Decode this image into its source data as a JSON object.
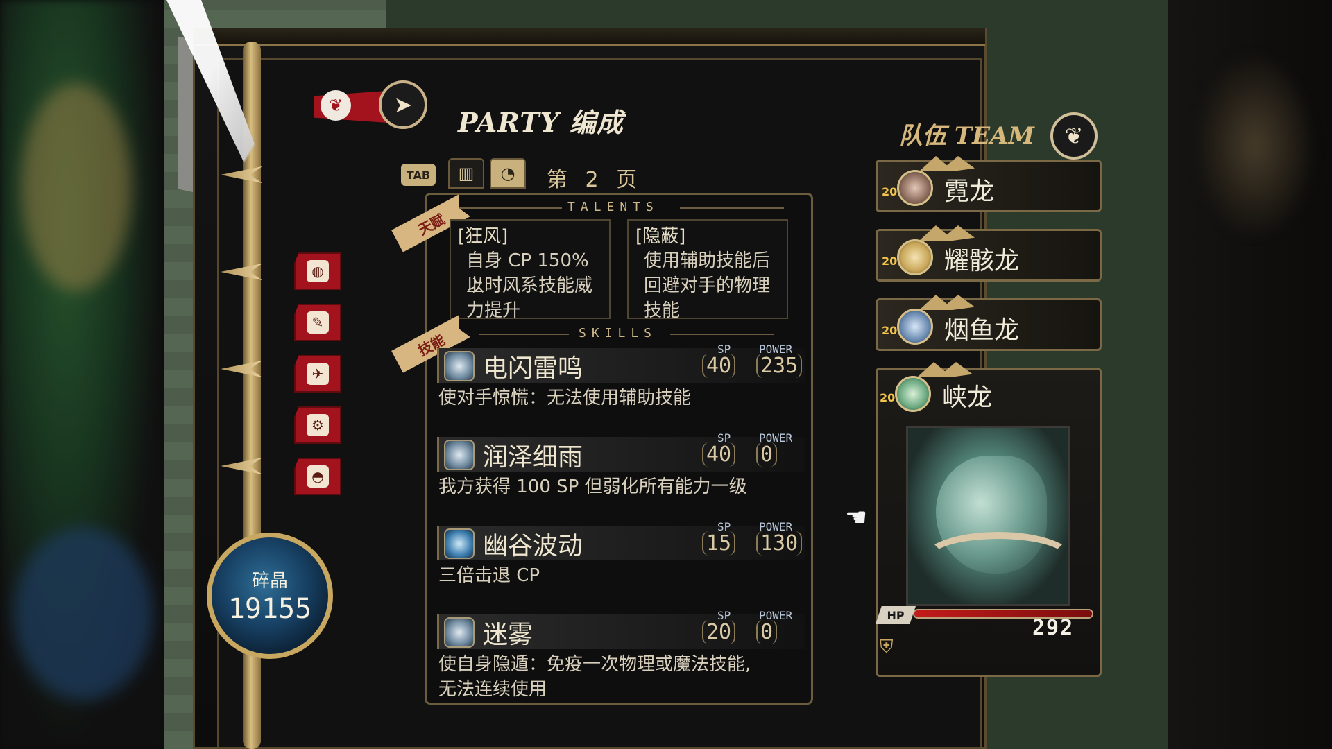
{
  "header": {
    "title": "PARTY 编成",
    "tab_key": "TAB",
    "page_label": "第 2 页"
  },
  "crystal": {
    "label": "碎晶",
    "value": "19155"
  },
  "side_tabs": [
    {
      "icon": "egg-icon",
      "glyph": "◍"
    },
    {
      "icon": "scroll-icon",
      "glyph": "✎"
    },
    {
      "icon": "map-icon",
      "glyph": "✈"
    },
    {
      "icon": "settings-icon",
      "glyph": "⚙"
    },
    {
      "icon": "bag-icon",
      "glyph": "◓"
    }
  ],
  "talents": {
    "section_title": "TALENTS",
    "ribbon": "天赋",
    "items": [
      {
        "name": "[狂风]",
        "desc": [
          "自身 CP 150% 以",
          "上时风系技能威",
          "力提升"
        ]
      },
      {
        "name": "[隐蔽]",
        "desc": [
          "使用辅助技能后",
          "回避对手的物理",
          "技能"
        ]
      }
    ]
  },
  "skills": {
    "section_title": "SKILLS",
    "ribbon": "技能",
    "sp_label": "SP",
    "power_label": "POWER",
    "items": [
      {
        "name": "电闪雷鸣",
        "sp": "40",
        "power": "235",
        "desc": [
          "使对手惊慌：无法使用辅助技能"
        ]
      },
      {
        "name": "润泽细雨",
        "sp": "40",
        "power": "0",
        "desc": [
          "我方获得 100 SP 但弱化所有能力一级"
        ]
      },
      {
        "name": "幽谷波动",
        "sp": "15",
        "power": "130",
        "desc": [
          "三倍击退 CP"
        ]
      },
      {
        "name": "迷雾",
        "sp": "20",
        "power": "0",
        "desc": [
          "使自身隐遁：免疫一次物理或魔法技能,",
          "无法连续使用"
        ]
      }
    ]
  },
  "team": {
    "title": "队伍 TEAM",
    "members": [
      {
        "level": "20",
        "name": "霓龙",
        "orb_color": "#8a6a5a"
      },
      {
        "level": "20",
        "name": "耀骸龙",
        "orb_color": "#c9a75a"
      },
      {
        "level": "20",
        "name": "烟鱼龙",
        "orb_color": "#6a8ab0"
      },
      {
        "level": "20",
        "name": "峡龙",
        "orb_color": "#6aa880"
      }
    ],
    "selected": {
      "hp_label": "HP",
      "hp_value": "292",
      "hp_fraction": 1.0
    }
  },
  "colors": {
    "accent_gold": "#c8a860",
    "tab_red": "#a3131d",
    "hp_red": "#c41b1b"
  }
}
